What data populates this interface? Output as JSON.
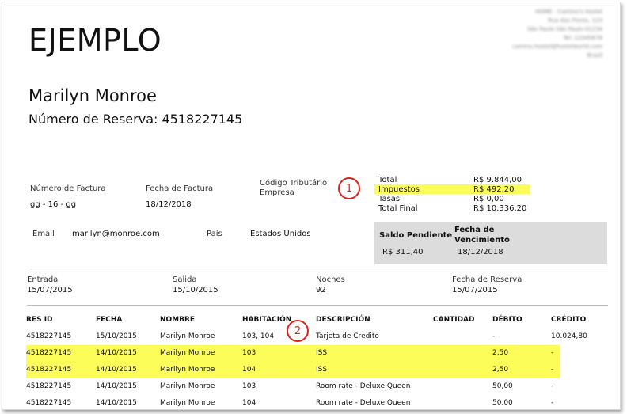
{
  "document": {
    "title": "EJEMPLO",
    "company_lines": [
      "HOME - Camino's Hostel",
      "Rua das Flores, 123",
      "São Paulo São Paulo 01234",
      "Tel: 12345678",
      "camino.hostel@hostelworld.com",
      "Brasil"
    ]
  },
  "guest": {
    "name": "Marilyn Monroe",
    "reservation_label": "Número de Reserva:",
    "reservation_number": "4518227145"
  },
  "invoice": {
    "number_label": "Número de Factura",
    "number_value": "gg - 16 - gg",
    "date_label": "Fecha de Factura",
    "date_value": "18/12/2018",
    "tax_code_label_1": "Código Tributário",
    "tax_code_label_2": "Empresa"
  },
  "totals": [
    {
      "label": "Total",
      "value": "R$ 9.844,00"
    },
    {
      "label": "Impuestos",
      "value": "R$ 492,20"
    },
    {
      "label": "Tasas",
      "value": "R$ 0,00"
    },
    {
      "label": "Total Final",
      "value": "R$ 10.336,20"
    }
  ],
  "contact": {
    "email_label": "Email",
    "email_value": "marilyn@monroe.com",
    "country_label": "País",
    "country_value": "Estados Unidos"
  },
  "pending": {
    "balance_label": "Saldo Pendiente",
    "balance_value": "R$ 311,40",
    "due_label_1": "Fecha de",
    "due_label_2": "Vencimiento",
    "due_value": "18/12/2018"
  },
  "stay": {
    "checkin_label": "Entrada",
    "checkin_value": "15/07/2015",
    "checkout_label": "Salida",
    "checkout_value": "15/10/2015",
    "nights_label": "Noches",
    "nights_value": "92",
    "booking_date_label": "Fecha de Reserva",
    "booking_date_value": "15/07/2015"
  },
  "callouts": [
    "1",
    "2"
  ],
  "highlight_color": "#fdfd5a",
  "callout_color": "#d9231d",
  "table": {
    "headers": [
      "RES ID",
      "FECHA",
      "NOMBRE",
      "HABITACIÓN",
      "DESCRIPCIÓN",
      "CANTIDAD",
      "DÉBITO",
      "CRÉDITO"
    ],
    "rows": [
      [
        "4518227145",
        "15/10/2015",
        "Marilyn Monroe",
        "103, 104",
        "Tarjeta de Credito",
        "",
        "-",
        "10.024,80"
      ],
      [
        "4518227145",
        "14/10/2015",
        "Marilyn Monroe",
        "103",
        "ISS",
        "",
        "2,50",
        "-"
      ],
      [
        "4518227145",
        "14/10/2015",
        "Marilyn Monroe",
        "104",
        "ISS",
        "",
        "2,50",
        "-"
      ],
      [
        "4518227145",
        "14/10/2015",
        "Marilyn Monroe",
        "103",
        "Room rate - Deluxe Queen",
        "",
        "50,00",
        "-"
      ],
      [
        "4518227145",
        "14/10/2015",
        "Marilyn Monroe",
        "104",
        "Room rate - Deluxe Queen",
        "",
        "50,00",
        "-"
      ]
    ]
  }
}
